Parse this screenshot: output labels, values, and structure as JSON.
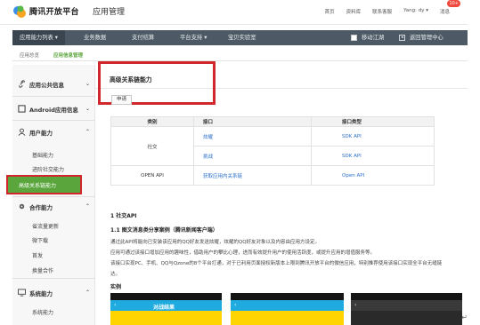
{
  "header": {
    "brand": "腾讯开放平台",
    "section": "应用管理",
    "links": [
      "首页",
      "资料库",
      "联系客服",
      "Yang: dy ▾",
      "消息"
    ],
    "badge": "10+"
  },
  "nav": {
    "items": [
      "应用能力列表 ▾",
      "业务数据",
      "支付结算",
      "平台支持 ▾",
      "宝贝实验室"
    ],
    "toggle_label": "移动江湖",
    "back_label": "返回管理中心"
  },
  "breadcrumb": [
    "应用总览",
    "应用信息管理"
  ],
  "sidebar": {
    "sections": [
      {
        "label": "应用公共信息",
        "chev": "⌄",
        "icon": "link-icon"
      },
      {
        "label": "Android应用信息",
        "chev": "⌄",
        "icon": "android-icon"
      },
      {
        "label": "用户能力",
        "chev": "⌃",
        "icon": "user-icon"
      },
      {
        "label": "合作能力",
        "chev": "⌃",
        "icon": "gear-icon"
      },
      {
        "label": "系统能力",
        "chev": "⌃",
        "icon": "monitor-icon"
      }
    ],
    "user_items": [
      "基础能力",
      "进阶社交能力",
      "高级关系链能力"
    ],
    "coop_items": [
      "省流量更新",
      "微下载",
      "首发",
      "换量合作"
    ],
    "system_items": [
      "系统能力"
    ]
  },
  "main": {
    "title": "高级关系链能力",
    "apply_button": "申请",
    "table": {
      "headers": [
        "类别",
        "接口",
        "接口类型"
      ],
      "rows": [
        {
          "category": "社交",
          "api": "炫耀",
          "type": "SDK API"
        },
        {
          "category": "",
          "api": "挑战",
          "type": "SDK API"
        },
        {
          "category": "OPEN API",
          "api": "获取应用内关系链",
          "type": "Open API"
        }
      ]
    },
    "doc": {
      "h1": "1 社交API",
      "h2": "1.1 图文消息类分享案例（腾讯新闻客户端）",
      "p1": "通过此API将能向已安装该应用的QQ好友发送炫耀，炫耀的QQ好友对象以及内容由应用方设定。",
      "p2": "应用可通过该接口增加应用的趣味性，借助用户的攀比心理，进而有效提升用户的使用活跃度，或提升应用的增值服务等。",
      "p3": "该接口实现PC、手机、QQ与Qzone的8个平台打通，对于已利用页面授权新版本上限到腾讯开放平台的微信应用，特别推荐使用该接口实现全平台无缝链",
      "p4": "达。",
      "example": "实例",
      "screen_title": "对战结果"
    }
  },
  "colors": {
    "nav_bg": "#4d5a66",
    "active_green": "#5aa63c",
    "highlight_red": "#d0262c",
    "link_blue": "#2a6fc9",
    "badge_red": "#f04a3c"
  }
}
